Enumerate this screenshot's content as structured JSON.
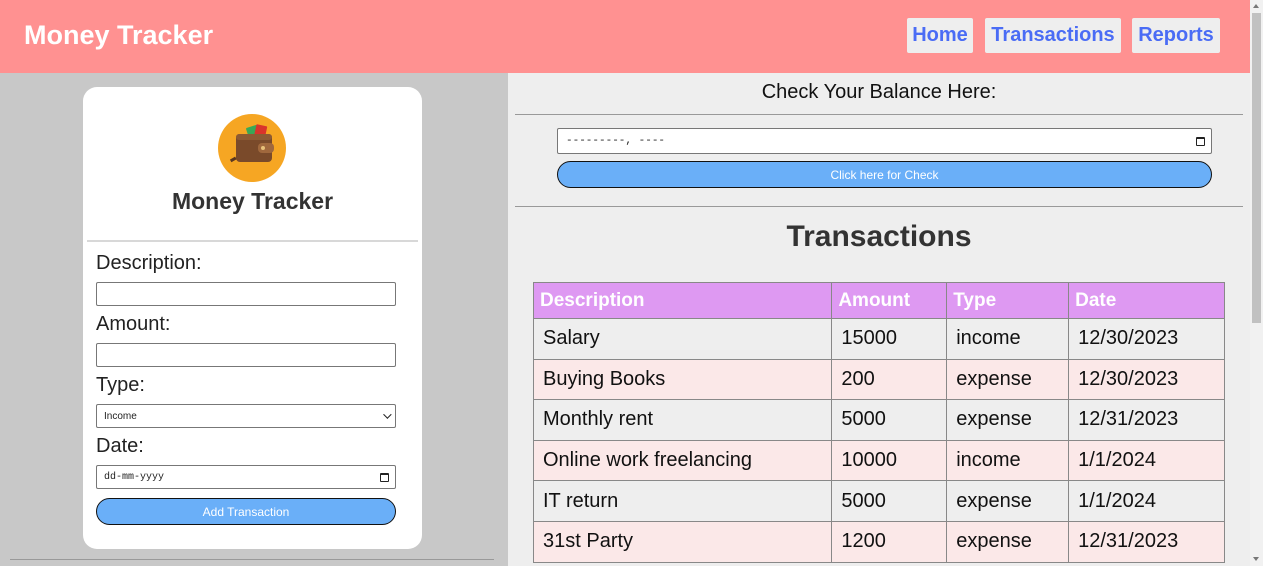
{
  "header": {
    "brand": "Money Tracker",
    "nav": [
      {
        "label": "Home"
      },
      {
        "label": "Transactions"
      },
      {
        "label": "Reports"
      }
    ]
  },
  "form": {
    "title": "Money Tracker",
    "logo_icon": "wallet-icon",
    "description_label": "Description:",
    "description_value": "",
    "amount_label": "Amount:",
    "amount_value": "",
    "type_label": "Type:",
    "type_selected": "Income",
    "date_label": "Date:",
    "date_placeholder": "dd-mm-yyyy",
    "submit_label": "Add Transaction"
  },
  "balance": {
    "title": "Check Your Balance Here:",
    "date_placeholder": "---------, ----",
    "check_label": "Click here for Check"
  },
  "transactions": {
    "title": "Transactions",
    "columns": [
      "Description",
      "Amount",
      "Type",
      "Date"
    ],
    "rows": [
      [
        "Salary",
        "15000",
        "income",
        "12/30/2023"
      ],
      [
        "Buying Books",
        "200",
        "expense",
        "12/30/2023"
      ],
      [
        "Monthly rent",
        "5000",
        "expense",
        "12/31/2023"
      ],
      [
        "Online work freelancing",
        "10000",
        "income",
        "1/1/2024"
      ],
      [
        "IT return",
        "5000",
        "expense",
        "1/1/2024"
      ],
      [
        "31st Party",
        "1200",
        "expense",
        "12/31/2023"
      ]
    ]
  },
  "colors": {
    "header_bg": "#ff9191",
    "nav_text": "#4a6cf5",
    "button_bg": "#6aaff8",
    "table_header_bg": "#de99f2",
    "row_alt_bg": "#fbe8e8"
  }
}
